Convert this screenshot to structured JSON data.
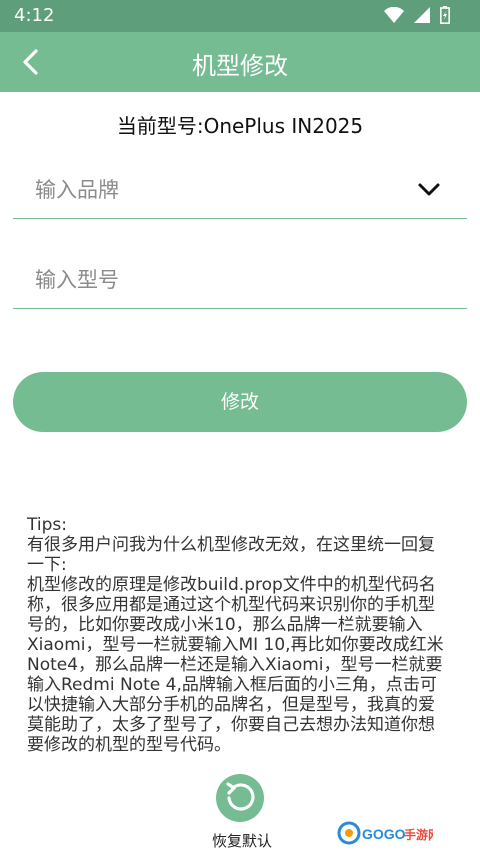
{
  "status_bar": {
    "time": "4:12",
    "icons": [
      "wifi-icon",
      "signal-icon",
      "battery-icon"
    ]
  },
  "app_bar": {
    "title": "机型修改",
    "back_icon": "back-arrow-icon"
  },
  "current_model": "当前型号:OnePlus IN2025",
  "brand_field": {
    "placeholder": "输入品牌",
    "icon": "chevron-down-icon"
  },
  "model_field": {
    "placeholder": "输入型号"
  },
  "submit_label": "修改",
  "tips": "Tips:\n有很多用户问我为什么机型修改无效，在这里统一回复一下:\n机型修改的原理是修改build.prop文件中的机型代码名称，很多应用都是通过这个机型代码来识别你的手机型号的，比如你要改成小米10，那么品牌一栏就要输入Xiaomi，型号一栏就要输入MI 10,再比如你要改成红米Note4，那么品牌一栏还是输入Xiaomi，型号一栏就要输入Redmi Note 4,品牌输入框后面的小三角，点击可以快捷输入大部分手机的品牌名，但是型号，我真的爱莫能助了，太多了型号了，你要自己去想办法知道你想要修改的机型的型号代码。",
  "restore_label": "恢复默认",
  "watermark": "GOGO手游网",
  "colors": {
    "primary": "#75bc92",
    "status_bar": "#5e9e7a"
  }
}
